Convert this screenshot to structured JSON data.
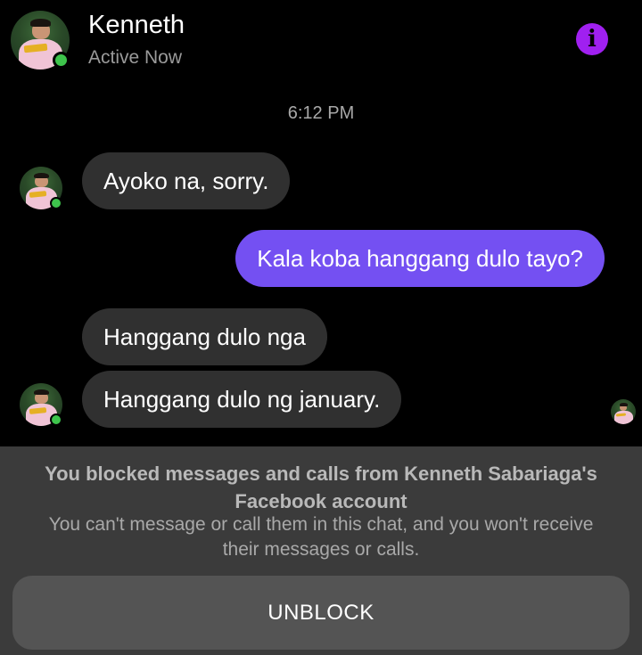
{
  "header": {
    "contact_name": "Kenneth",
    "status": "Active Now",
    "info_icon_glyph": "i",
    "online_color": "#3ec44c",
    "accent_color": "#a020f0"
  },
  "conversation": {
    "timestamp": "6:12 PM",
    "messages": [
      {
        "sender": "Kenneth",
        "text": "Ayoko na, sorry."
      },
      {
        "sender": "me",
        "text": "Kala koba hanggang dulo tayo?"
      },
      {
        "sender": "Kenneth",
        "text": "Hanggang dulo nga"
      },
      {
        "sender": "Kenneth",
        "text": "Hanggang dulo ng january."
      }
    ],
    "my_bubble_color": "#7450f2",
    "their_bubble_color": "#303030"
  },
  "blocked_notice": {
    "title": "You blocked messages and calls from Kenneth Sabariaga's Facebook account",
    "description": "You can't message or call them in this chat, and you won't receive their messages or calls.",
    "unblock_label": "UNBLOCK"
  }
}
